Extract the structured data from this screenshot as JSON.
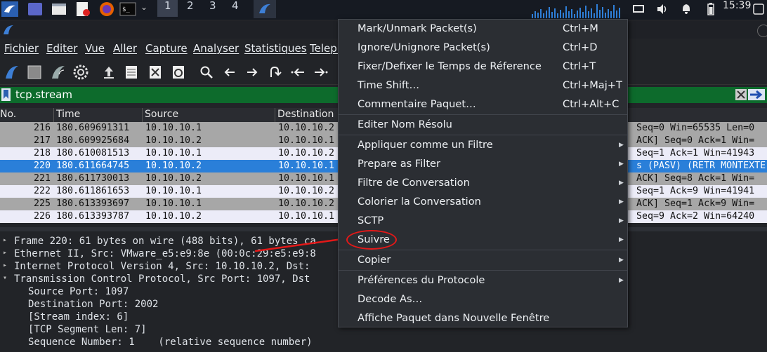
{
  "taskbar": {
    "workspaces": [
      "1",
      "2",
      "3",
      "4"
    ],
    "clock": "15:39"
  },
  "menubar": {
    "items": [
      "Fichier",
      "Editer",
      "Vue",
      "Aller",
      "Capture",
      "Analyser",
      "Statistiques",
      "Teleph"
    ]
  },
  "filter": {
    "value": "tcp.stream"
  },
  "packet_list": {
    "headers": {
      "no": "No.",
      "time": "Time",
      "source": "Source",
      "destination": "Destination"
    },
    "rows": [
      {
        "no": "216",
        "time": "180.609691311",
        "source": "10.10.10.1",
        "destination": "10.10.10.2",
        "info": "Seq=0 Win=65535 Len=0",
        "style": "gray"
      },
      {
        "no": "217",
        "time": "180.609925684",
        "source": "10.10.10.2",
        "destination": "10.10.10.1",
        "info": "ACK] Seq=0 Ack=1 Win=",
        "style": "gray"
      },
      {
        "no": "218",
        "time": "180.610081513",
        "source": "10.10.10.1",
        "destination": "10.10.10.2",
        "info": "Seq=1 Ack=1 Win=41943",
        "style": "light"
      },
      {
        "no": "220",
        "time": "180.611664745",
        "source": "10.10.10.2",
        "destination": "10.10.10.1",
        "info": "s (PASV) (RETR MONTEXTE",
        "style": "selected"
      },
      {
        "no": "221",
        "time": "180.611730013",
        "source": "10.10.10.2",
        "destination": "10.10.10.1",
        "info": "ACK] Seq=8 Ack=1 Win=",
        "style": "gray"
      },
      {
        "no": "222",
        "time": "180.611861653",
        "source": "10.10.10.1",
        "destination": "10.10.10.2",
        "info": "Seq=1 Ack=9 Win=41941",
        "style": "light"
      },
      {
        "no": "225",
        "time": "180.613393697",
        "source": "10.10.10.1",
        "destination": "10.10.10.2",
        "info": "ACK] Seq=1 Ack=9 Win=",
        "style": "gray"
      },
      {
        "no": "226",
        "time": "180.613393787",
        "source": "10.10.10.2",
        "destination": "10.10.10.1",
        "info": "Seq=9 Ack=2 Win=64240",
        "style": "light"
      }
    ]
  },
  "details": {
    "lines": [
      "Frame 220: 61 bytes on wire (488 bits), 61 bytes ca",
      "Ethernet II, Src: VMware_e5:e9:8e (00:0c:29:e5:e9:8",
      "Internet Protocol Version 4, Src: 10.10.10.2, Dst:",
      "Transmission Control Protocol, Src Port: 1097, Dst",
      "Source Port: 1097",
      "Destination Port: 2002",
      "[Stream index: 6]",
      "[TCP Segment Len: 7]",
      "Sequence Number: 1    (relative sequence number)"
    ]
  },
  "context_menu": {
    "items": [
      {
        "label": "Mark/Unmark Packet(s)",
        "shortcut": "Ctrl+M"
      },
      {
        "label": "Ignore/Unignore Packet(s)",
        "shortcut": "Ctrl+D"
      },
      {
        "label": "Fixer/Defixer le Temps de Réference",
        "shortcut": "Ctrl+T"
      },
      {
        "label": "Time Shift…",
        "shortcut": "Ctrl+Maj+T"
      },
      {
        "label": "Commentaire Paquet…",
        "shortcut": "Ctrl+Alt+C"
      },
      {
        "label": "Editer Nom Résolu"
      },
      {
        "label": "Appliquer comme un Filtre",
        "submenu": true
      },
      {
        "label": "Prepare as Filter",
        "submenu": true
      },
      {
        "label": "Filtre de Conversation",
        "submenu": true
      },
      {
        "label": "Colorier la Conversation",
        "submenu": true
      },
      {
        "label": "SCTP",
        "submenu": true
      },
      {
        "label": "Suivre",
        "submenu": true
      },
      {
        "label": "Copier",
        "submenu": true
      },
      {
        "label": "Préférences du Protocole",
        "submenu": true
      },
      {
        "label": "Decode As…"
      },
      {
        "label": "Affiche Paquet dans Nouvelle Fenêtre"
      }
    ]
  },
  "colors": {
    "filter_bg": "#0d6b2c",
    "selected_row": "#2a7fd9",
    "gray_row": "#a7a7a7",
    "light_row": "#ececf8",
    "annotation": "#e31818"
  }
}
